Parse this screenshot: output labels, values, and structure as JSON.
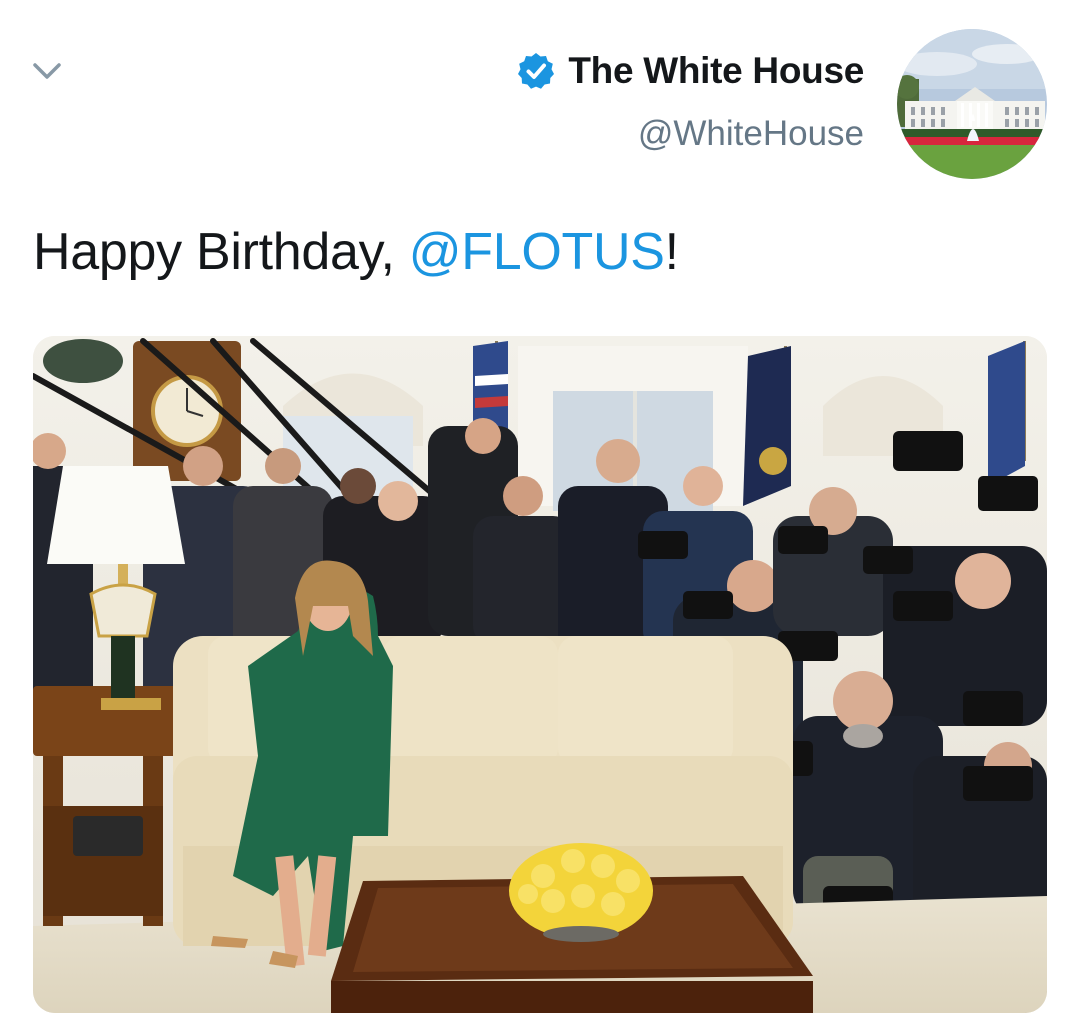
{
  "tweet": {
    "author": {
      "display_name": "The White House",
      "handle": "@WhiteHouse",
      "verified": true,
      "avatar_icon": "white-house-avatar"
    },
    "text_prefix": "Happy Birthday, ",
    "mention": "@FLOTUS",
    "text_suffix": "!",
    "media_icon": "oval-office-photo"
  },
  "colors": {
    "accent": "#1b95e0",
    "name": "#14171a",
    "secondary": "#657786",
    "chevron": "#8899a6"
  }
}
